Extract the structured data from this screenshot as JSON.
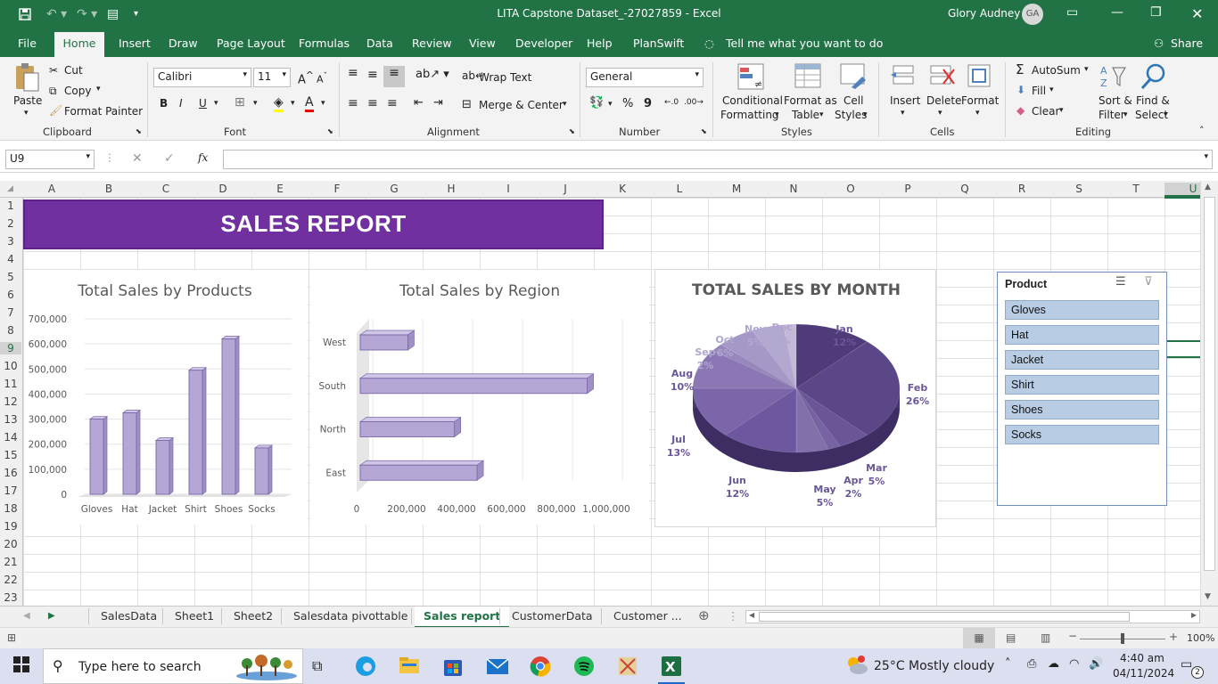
{
  "title_bar": {
    "file_title": "LITA Capstone Dataset_-27027859",
    "separator": "-",
    "app": "Excel",
    "user_name": "Glory Audney",
    "initials": "GA",
    "share": "Share"
  },
  "ribbon_tabs": [
    "File",
    "Home",
    "Insert",
    "Draw",
    "Page Layout",
    "Formulas",
    "Data",
    "Review",
    "View",
    "Developer",
    "Help",
    "PlanSwift"
  ],
  "tell_me": "Tell me what you want to do",
  "clipboard": {
    "paste": "Paste",
    "cut": "Cut",
    "copy": "Copy",
    "format_painter": "Format Painter",
    "group": "Clipboard"
  },
  "font": {
    "name": "Calibri",
    "size": "11",
    "bold": "B",
    "italic": "I",
    "underline": "U",
    "group": "Font"
  },
  "alignment": {
    "wrap": "Wrap Text",
    "merge": "Merge & Center",
    "group": "Alignment"
  },
  "number": {
    "format": "General",
    "percent": "%",
    "comma": "9",
    "group": "Number"
  },
  "styles": {
    "conditional": "Conditional",
    "formatting": "Formatting",
    "format_as": "Format as",
    "table": "Table",
    "cell": "Cell",
    "cell_styles": "Styles",
    "group": "Styles"
  },
  "cells": {
    "insert": "Insert",
    "delete": "Delete",
    "format": "Format",
    "group": "Cells"
  },
  "editing": {
    "autosum": "AutoSum",
    "fill": "Fill",
    "clear": "Clear",
    "sort1": "Sort &",
    "sort2": "Filter",
    "find1": "Find &",
    "find2": "Select",
    "group": "Editing"
  },
  "formula_bar": {
    "name_box": "U9",
    "fx": "fx",
    "formula": ""
  },
  "columns": [
    "A",
    "B",
    "C",
    "D",
    "E",
    "F",
    "G",
    "H",
    "I",
    "J",
    "K",
    "L",
    "M",
    "N",
    "O",
    "P",
    "Q",
    "R",
    "S",
    "T",
    "U"
  ],
  "rows": [
    "1",
    "2",
    "3",
    "4",
    "5",
    "6",
    "7",
    "8",
    "9",
    "10",
    "11",
    "12",
    "13",
    "14",
    "15",
    "16",
    "17",
    "18",
    "19",
    "20",
    "21",
    "22",
    "23"
  ],
  "banner": "SALES REPORT",
  "chart_data": [
    {
      "type": "bar",
      "title": "Total Sales by Products",
      "categories": [
        "Gloves",
        "Hat",
        "Jacket",
        "Shirt",
        "Shoes",
        "Socks"
      ],
      "values": [
        300000,
        325000,
        215000,
        495000,
        620000,
        185000
      ],
      "ylim": [
        0,
        700000
      ],
      "yticks": [
        "700,000",
        "600,000",
        "500,000",
        "400,000",
        "300,000",
        "200,000",
        "100,000",
        "0"
      ]
    },
    {
      "type": "bar",
      "title": "Total Sales by Region",
      "categories": [
        "West",
        "South",
        "North",
        "East"
      ],
      "values": [
        210000,
        1000000,
        415000,
        515000
      ],
      "xlim": [
        0,
        1100000
      ],
      "xticks": [
        "0",
        "200,000",
        "400,000",
        "600,000",
        "800,000",
        "1,000,000"
      ]
    },
    {
      "type": "pie",
      "title": "TOTAL SALES BY MONTH",
      "slices": [
        {
          "label": "Jan",
          "pct": "12%",
          "value": 12
        },
        {
          "label": "Feb",
          "pct": "26%",
          "value": 26
        },
        {
          "label": "Mar",
          "pct": "5%",
          "value": 5
        },
        {
          "label": "Apr",
          "pct": "2%",
          "value": 2
        },
        {
          "label": "May",
          "pct": "5%",
          "value": 5
        },
        {
          "label": "Jun",
          "pct": "12%",
          "value": 12
        },
        {
          "label": "Jul",
          "pct": "13%",
          "value": 13
        },
        {
          "label": "Aug",
          "pct": "10%",
          "value": 10
        },
        {
          "label": "Sep",
          "pct": "2%",
          "value": 2
        },
        {
          "label": "Oct",
          "pct": "6%",
          "value": 6
        },
        {
          "label": "Nov",
          "pct": "5%",
          "value": 5
        },
        {
          "label": "Dec",
          "pct": "2%",
          "value": 2
        }
      ]
    }
  ],
  "slicer": {
    "title": "Product",
    "items": [
      "Gloves",
      "Hat",
      "Jacket",
      "Shirt",
      "Shoes",
      "Socks"
    ]
  },
  "sheets": [
    "SalesData",
    "Sheet1",
    "Sheet2",
    "Salesdata pivottable",
    "Sales report",
    "CustomerData",
    "Customer ..."
  ],
  "active_sheet": "Sales report",
  "status": {
    "zoom": "100%"
  },
  "taskbar": {
    "search": "Type here to search",
    "weather": "25°C  Mostly cloudy",
    "time": "4:40 am",
    "date": "04/11/2024",
    "notif": "2"
  },
  "colors": {
    "excel_green": "#217346",
    "banner": "#7030a0",
    "bar": "#b4a7d6",
    "bar_edge": "#7b68a8",
    "slicer": "#b8cce4"
  }
}
